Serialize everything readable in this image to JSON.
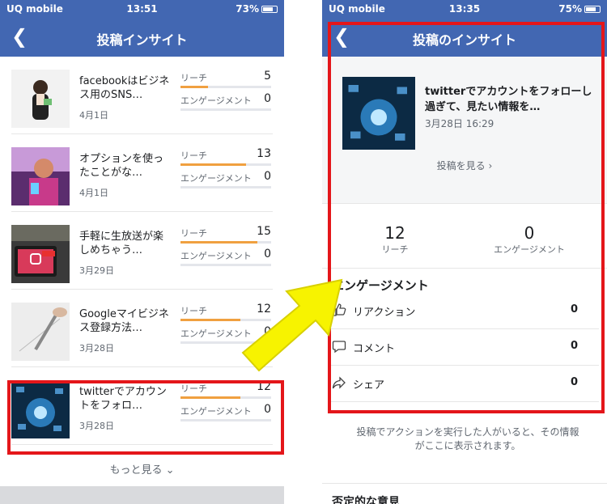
{
  "left": {
    "status": {
      "carrier": "UQ mobile",
      "time": "13:51",
      "battery": "73%",
      "battery_level": 0.73
    },
    "title": "投稿インサイト",
    "reach_label": "リーチ",
    "engagement_label": "エンゲージメント",
    "posts": [
      {
        "text": "facebookはビジネス用のSNS…",
        "date": "4月1日",
        "reach": "5",
        "engagement": "0",
        "reach_fill": 0.3
      },
      {
        "text": "オプションを使ったことがな…",
        "date": "4月1日",
        "reach": "13",
        "engagement": "0",
        "reach_fill": 0.72
      },
      {
        "text": "手軽に生放送が楽しめちゃう…",
        "date": "3月29日",
        "reach": "15",
        "engagement": "0",
        "reach_fill": 0.85
      },
      {
        "text": "Googleマイビジネス登録方法…",
        "date": "3月28日",
        "reach": "12",
        "engagement": "0",
        "reach_fill": 0.66
      },
      {
        "text": "twitterでアカウントをフォロ…",
        "date": "3月28日",
        "reach": "12",
        "engagement": "0",
        "reach_fill": 0.66
      }
    ],
    "more": "もっと見る"
  },
  "right": {
    "status": {
      "carrier": "UQ mobile",
      "time": "13:35",
      "battery": "75%",
      "battery_level": 0.75
    },
    "title": "投稿のインサイト",
    "post": {
      "title": "twitterでアカウントをフォローし過ぎて、見たい情報を…",
      "date": "3月28日 16:29",
      "view": "投稿を見る"
    },
    "metrics": [
      {
        "value": "12",
        "label": "リーチ"
      },
      {
        "value": "0",
        "label": "エンゲージメント"
      }
    ],
    "engagement_heading": "エンゲージメント",
    "engagement_rows": [
      {
        "icon": "thumbs-up-icon",
        "label": "リアクション",
        "value": "0"
      },
      {
        "icon": "comment-icon",
        "label": "コメント",
        "value": "0"
      },
      {
        "icon": "share-icon",
        "label": "シェア",
        "value": "0"
      }
    ],
    "note": "投稿でアクションを実行した人がいると、その情報がここに表示されます。",
    "cutoff_heading": "否定的な意見"
  },
  "colors": {
    "header": "#4267b2",
    "highlight": "#e4161a",
    "arrow": "#f7f300",
    "bar": "#f0a040"
  }
}
